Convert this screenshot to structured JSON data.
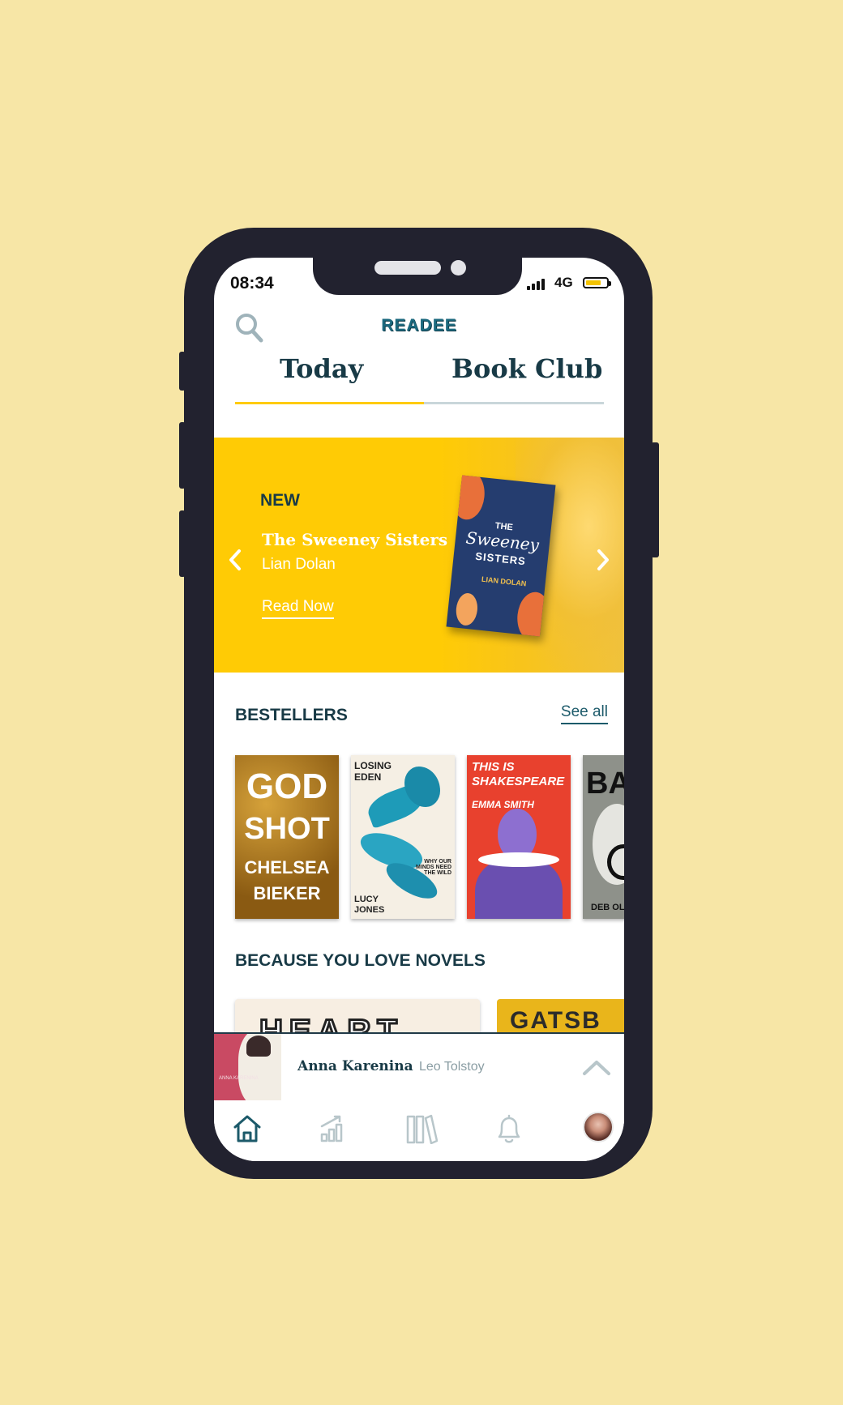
{
  "status_bar": {
    "time": "08:34",
    "network": "4G"
  },
  "header": {
    "brand": "READEE",
    "tabs": [
      {
        "label": "Today",
        "active": true
      },
      {
        "label": "Book Club",
        "active": false
      }
    ]
  },
  "hero": {
    "badge": "NEW",
    "title": "The Sweeney Sisters",
    "author": "Lian Dolan",
    "cta": "Read Now",
    "book_cover": {
      "title_line1": "THE",
      "title_line2": "Sweeney",
      "title_line3": "SISTERS",
      "author": "LIAN DOLAN"
    }
  },
  "bestsellers": {
    "title": "BESTELLERS",
    "see_all": "See all",
    "books": [
      {
        "lines": [
          "GOD",
          "SHOT",
          "CHELSEA",
          "BIEKER"
        ]
      },
      {
        "top": "LOSING EDEN",
        "sub": "WHY OUR MINDS NEED THE WILD",
        "author": "LUCY JONES"
      },
      {
        "top": "THIS IS SHAKESPEARE",
        "author": "EMMA SMITH"
      },
      {
        "top": "BA",
        "author": "DEB OL"
      }
    ]
  },
  "novels": {
    "title": "BECAUSE YOU LOVE NOVELS",
    "books": [
      {
        "text": "HEART"
      },
      {
        "text": "GATSB"
      }
    ]
  },
  "now_playing": {
    "title": "Anna Karenina",
    "author": "Leo Tolstoy",
    "cover_text": "ANNA KARENINA"
  },
  "nav": [
    "home-icon",
    "stats-icon",
    "library-icon",
    "bell-icon",
    "profile-avatar"
  ],
  "colors": {
    "accent": "#ffcb05",
    "primary": "#183a46",
    "brand": "#1c6a7f",
    "background": "#f7e6a6"
  }
}
